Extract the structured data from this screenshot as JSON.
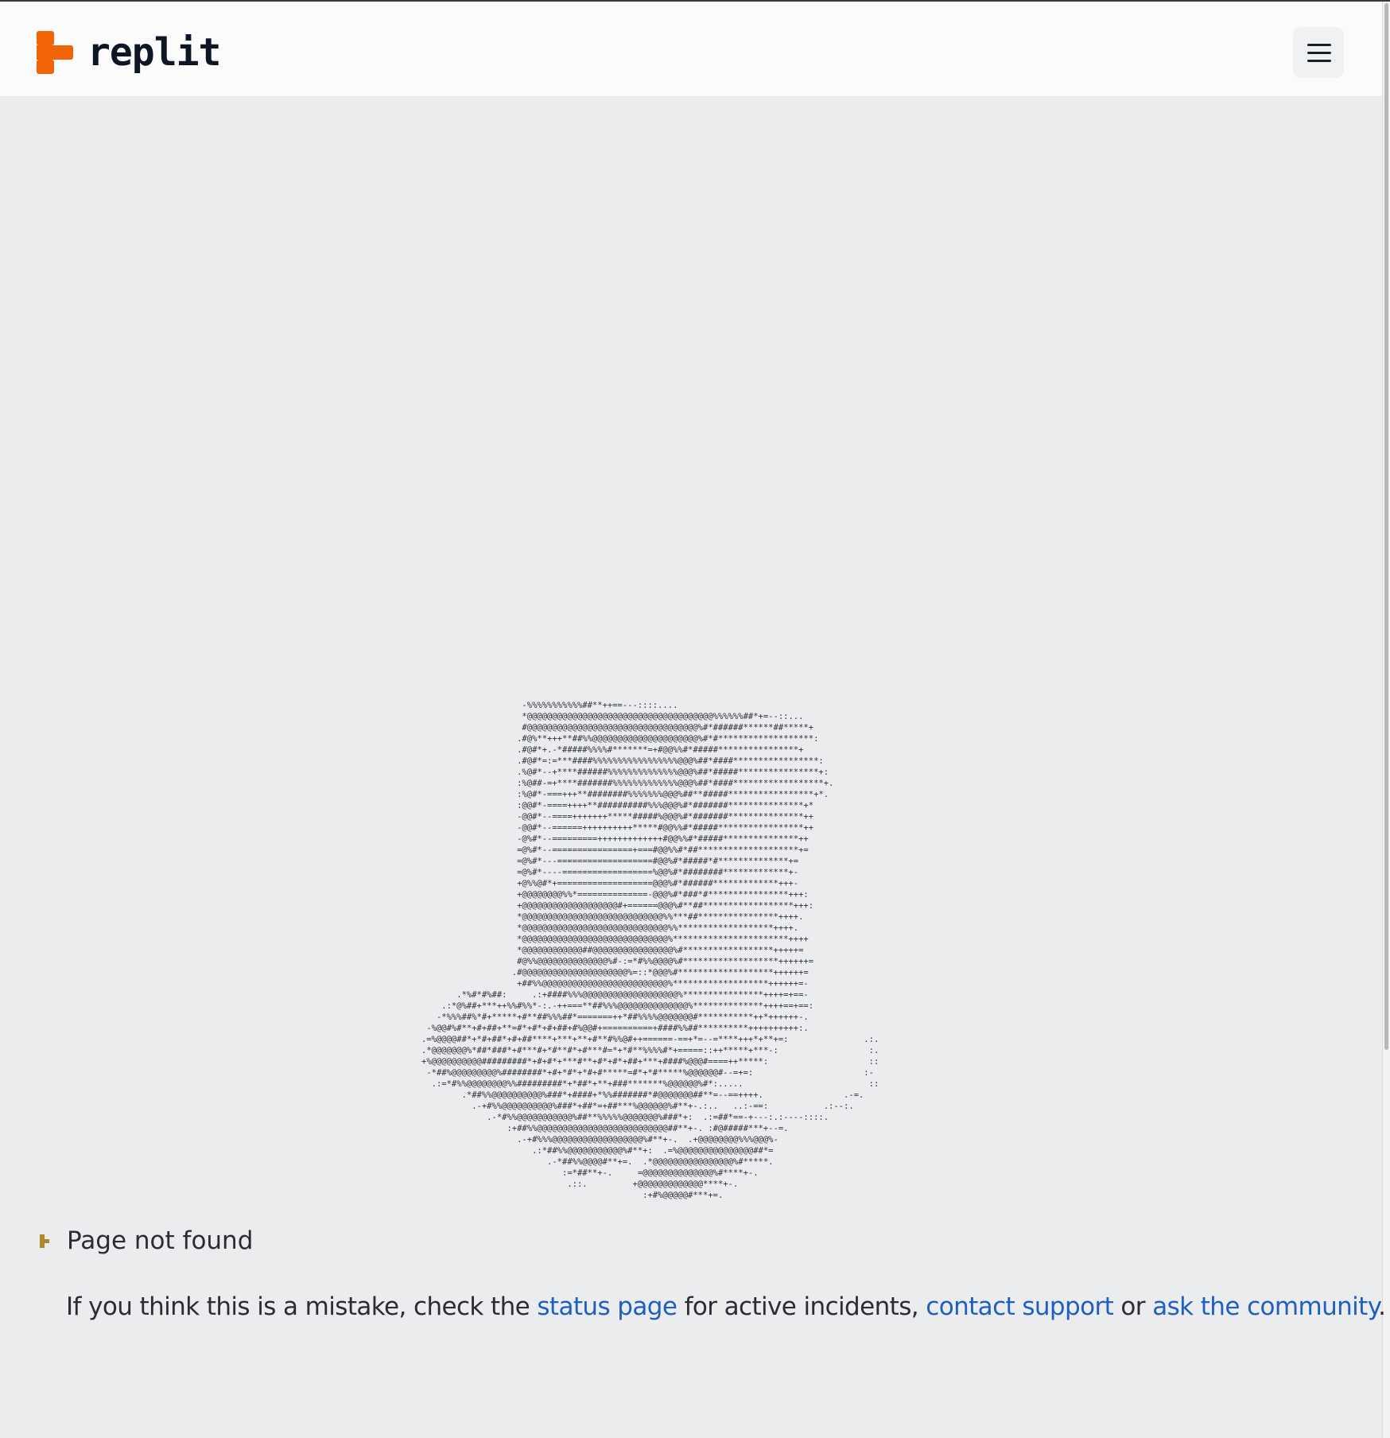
{
  "header": {
    "logo_text": "replit",
    "logo_color": "#f26207",
    "menu_icon": "hamburger-menu-icon"
  },
  "ascii_art": "                    -%%%%%%%%%%%##**++==---::::....\n                    *@@@@@@@@@@@@@@@@@@@@@@@@@@@@@@@@@@@@@%%%%%%##*+=--::...\n                    #@@@@@@@@@@@@@@@@@@@@@@@@@@@@@@@@@@%#*######******##*****+\n                   .#@%**+++**##%%@@@@@@@@@@@@@@@@@@@@@%#*#*******************:\n                   .#@#*+.-*#####%%%%#*******=+#@@%%#*#####****************+\n                   .#@#*=:=***####%%%%%%%%%%%%%%%%%@@@%##*####*****************:\n                   .%@#*--+****######%%%%%%%%%%%%%%@@@%##*#####****************+:\n                   :%@##-=+****#######%%%%%%%%%%%%%@@@%##*####******************+.\n                   :%@#*-===+++**########%%%%%%%@@@%##**#####*****************+*.\n                   :@@#*-====++++**##########%%%@@@%#*#######***************+*\n                   -@@#*--====+++++++*****#####%@@@%#*#######***************++\n                   -@@#*--======++++++++++*****#@@%%#*#####*****************++\n                   -@%#*--=========+++++++++++++#@@%%#*#####***************++\n                   =@%#*--================+===#@@%%#*##********************+=\n                   =@%#*---===================#@@%#*#####*#**************+=\n                   =@%#*----==================%@@%#*########*************+-\n                   +@%%@#*+===================@@@%#*######*************+++-\n                   +@@@@@@@@%%*==============-@@@%#*###*#****************+++:\n                   +@@@@@@@@@@@@@@@@@@@#+======@@@%#**##******************+++:\n                   *@@@@@@@@@@@@@@@@@@@@@@@@@@@@%%***##****************++++.\n                   *@@@@@@@@@@@@@@@@@@@@@@@@@@@@@%%*******************++++.\n                   *@@@@@@@@@@@@@@@@@@@@@@@@@@@@@%***********************++++\n                   *@@@@@@@@@@@@##@@@@@@@@@@@@@@@@%#******************+++++=\n                   #@%%@@@@@@@@@@@@@@%#-:=*#%%@@@@%#*******************++++++=\n                  .#@@@@@@@@@@@@@@@@@@@@@%=::*@@@%#*******************++++++=\n                   +##%%@@@@@@@@@@@@@@@@@@@@@@@@@%*******************++++++=-\n       .*%#*#%##:     .:+####%%%@@@@@@@@@@@@@@@@@@@%****************++++=+==-\n    .:*@%##+***++%%#%%*-:.-++===**##%%%@@@@@@@@@@@@@@%**************++++==+==:\n   -*%%%##%*#+*****+#**##%%%##*=======++*##%%%%@@@@@@@#***********++*++++++-.\n -%@@#%#**+#+##+**=#*+#*+#+##+#%@@#+==========+####%%##**********++++++++++:.\n.=%@@@@##*+*#+##*+#+##****+***+**+#**#%%@#++======-==+*=--=****+++*+**+=:               .:.\n.*@@@@@@@%*##*###*+#***#+*#**#*+#***#=*+*#**%%%%#*+=====::++*****+***-:                  :.\n+%@@@@@@@@@@#########*+#+#*+***#**+#*+#*+##+***+####%@@@#====++*****:                    ::\n -*##%@@@@@@@@@%########*+#+*#*+*#+#*****=#*+*#*****%@@@@@@#--=+=:                      :-\n  .:=*#%%@@@@@@@@%%#########*+*##*+**+###*******%@@@@@@%#*:.....                         ::\n        .*##%%@@@@@@@@@@%###*+####+*%%#######*#@@@@@@@##**=--==++++.                .-=.\n          .-+#%%@@@@@@@@@@%###*+##*=+##***%@@@@@@%#**+-.:..   ..:-==:           .:--:.\n             .-*#%%@@@@@@@@@@@%##**%%%%%@@@@@@@%###*+:  .:=##*==-+---:.:----::::.\n                 :+##%%@@@@@@@@@@@@@@@@@@@@@@@@@@##**+-. :#@#####***+--=.\n                   .-+#%%%@@@@@@@@@@@@@@@@@@%#**+-.  .+@@@@@@@@%%%@@@%-\n                      .:*##%%@@@@@@@@@@@%#**+:  .=%@@@@@@@@@@@@@@@##*=\n                         .-*##%%@@@@#**+=.  .*@@@@@@@@@@@@@@@@%#*****.\n                            :=*##**+-.     =@@@@@@@@@@@@@@%#****+-.\n                             .::.         +@@@@@@@@@@@@@****+-.\n                                            :+#%@@@@@#***+=.",
  "notfound": {
    "icon": "replit-mini-logo-icon",
    "text": "Page not found"
  },
  "message": {
    "prefix": "If you think this is a mistake, check the ",
    "status_link": "status page",
    "middle": " for active incidents, ",
    "support_link": "contact support",
    "or_text": " or ",
    "community_link": "ask the community",
    "suffix": "."
  },
  "colors": {
    "background": "#ebecee",
    "header_background": "#fbfbfb",
    "link": "#1f5fc0",
    "notfound_icon": "#b08a2a"
  }
}
